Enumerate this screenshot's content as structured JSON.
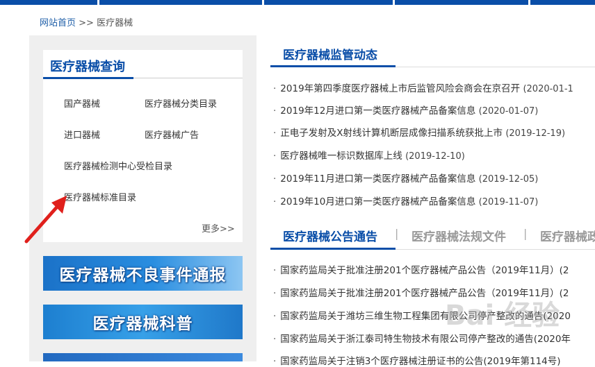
{
  "breadcrumb": {
    "home": "网站首页",
    "separator": " >> ",
    "current": "医疗器械"
  },
  "query": {
    "title": "医疗器械查询",
    "links": [
      "国产器械",
      "医疗器械分类目录",
      "进口器械",
      "医疗器械广告",
      "医疗器械检测中心受检目录",
      "医疗器械标准目录"
    ],
    "more": "更多>>"
  },
  "banners": [
    "医疗器械不良事件通报",
    "医疗器械科普"
  ],
  "news": {
    "title": "医疗器械监管动态",
    "items": [
      {
        "title": "2019年第四季度医疗器械上市后监管风险会商会在京召开",
        "date": "(2020-01-1"
      },
      {
        "title": "2019年12月进口第一类医疗器械产品备案信息",
        "date": "(2020-01-07)"
      },
      {
        "title": "正电子发射及X射线计算机断层成像扫描系统获批上市",
        "date": "(2019-12-19)"
      },
      {
        "title": "医疗器械唯一标识数据库上线",
        "date": "(2019-12-10)"
      },
      {
        "title": "2019年11月进口第一类医疗器械产品备案信息",
        "date": "(2019-12-05)"
      },
      {
        "title": "2019年10月进口第一类医疗器械产品备案信息",
        "date": "(2019-11-07)"
      }
    ]
  },
  "notice": {
    "tabs": [
      "医疗器械公告通告",
      "医疗器械法规文件",
      "医疗器械政"
    ],
    "items": [
      "国家药监局关于批准注册201个医疗器械产品公告（2019年11月）(2",
      "国家药监局关于批准注册201个医疗器械产品公告（2019年11月）(2",
      "国家药监局关于潍坊三维生物工程集团有限公司停产整改的通告(2020",
      "国家药监局关于浙江泰司特生物技术有限公司停产整改的通告(2020年",
      "国家药监局关于注销3个医疗器械注册证书的公告(2019年第114号)"
    ]
  },
  "watermark": "Bai 经验",
  "colors": {
    "accent": "#0a4ea8",
    "arrow": "#e0201c"
  }
}
